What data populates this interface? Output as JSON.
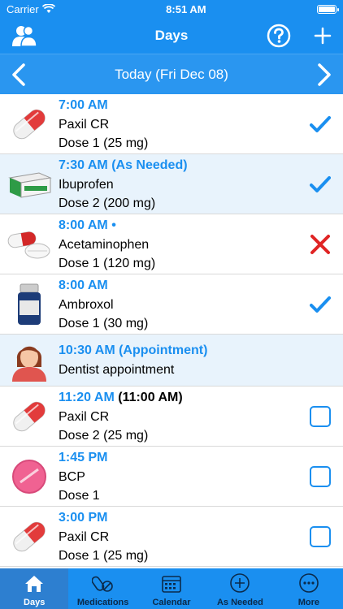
{
  "status_bar": {
    "carrier": "Carrier",
    "time": "8:51 AM"
  },
  "navbar": {
    "title": "Days",
    "users_icon": "people-icon",
    "help_icon": "help-icon",
    "add_icon": "plus-icon"
  },
  "datebar": {
    "date": "Today (Fri Dec 08)"
  },
  "entries": [
    {
      "time": "7:00 AM",
      "extra": "",
      "name": "Paxil CR",
      "dose": "Dose 1 (25 mg)",
      "icon": "pill-capsule-red",
      "status": "taken",
      "alt": false
    },
    {
      "time": "7:30 AM (As Needed)",
      "extra": "",
      "name": "Ibuprofen",
      "dose": "Dose 2 (200 mg)",
      "icon": "medicine-box",
      "status": "taken",
      "alt": true
    },
    {
      "time": "8:00 AM •",
      "extra": "",
      "name": "Acetaminophen",
      "dose": "Dose 1 (120 mg)",
      "icon": "capsule-and-tablet",
      "status": "missed",
      "alt": false
    },
    {
      "time": "8:00 AM",
      "extra": "",
      "name": "Ambroxol",
      "dose": "Dose 1 (30 mg)",
      "icon": "pill-bottle",
      "status": "taken",
      "alt": false
    },
    {
      "time": "10:30 AM (Appointment)",
      "extra": "",
      "name": "Dentist appointment",
      "dose": "",
      "icon": "woman-avatar",
      "status": "none",
      "alt": true
    },
    {
      "time": "11:20 AM",
      "extra": "(11:00 AM)",
      "name": "Paxil CR",
      "dose": "Dose 2 (25 mg)",
      "icon": "pill-capsule-red",
      "status": "pending",
      "alt": false
    },
    {
      "time": "1:45 PM",
      "extra": "",
      "name": "BCP",
      "dose": "Dose 1",
      "icon": "pink-tablet",
      "status": "pending",
      "alt": false
    },
    {
      "time": "3:00 PM",
      "extra": "",
      "name": "Paxil CR",
      "dose": "Dose 1 (25 mg)",
      "icon": "pill-capsule-red",
      "status": "pending",
      "alt": false
    }
  ],
  "tabs": [
    {
      "label": "Days",
      "icon": "house-icon",
      "active": true
    },
    {
      "label": "Medications",
      "icon": "pills-icon",
      "active": false
    },
    {
      "label": "Calendar",
      "icon": "calendar-icon",
      "active": false
    },
    {
      "label": "As Needed",
      "icon": "plus-circle-icon",
      "active": false
    },
    {
      "label": "More",
      "icon": "more-icon",
      "active": false
    }
  ],
  "colors": {
    "primary": "#1a8ff0",
    "missed": "#e02424",
    "alt_row": "#e8f3fc"
  }
}
